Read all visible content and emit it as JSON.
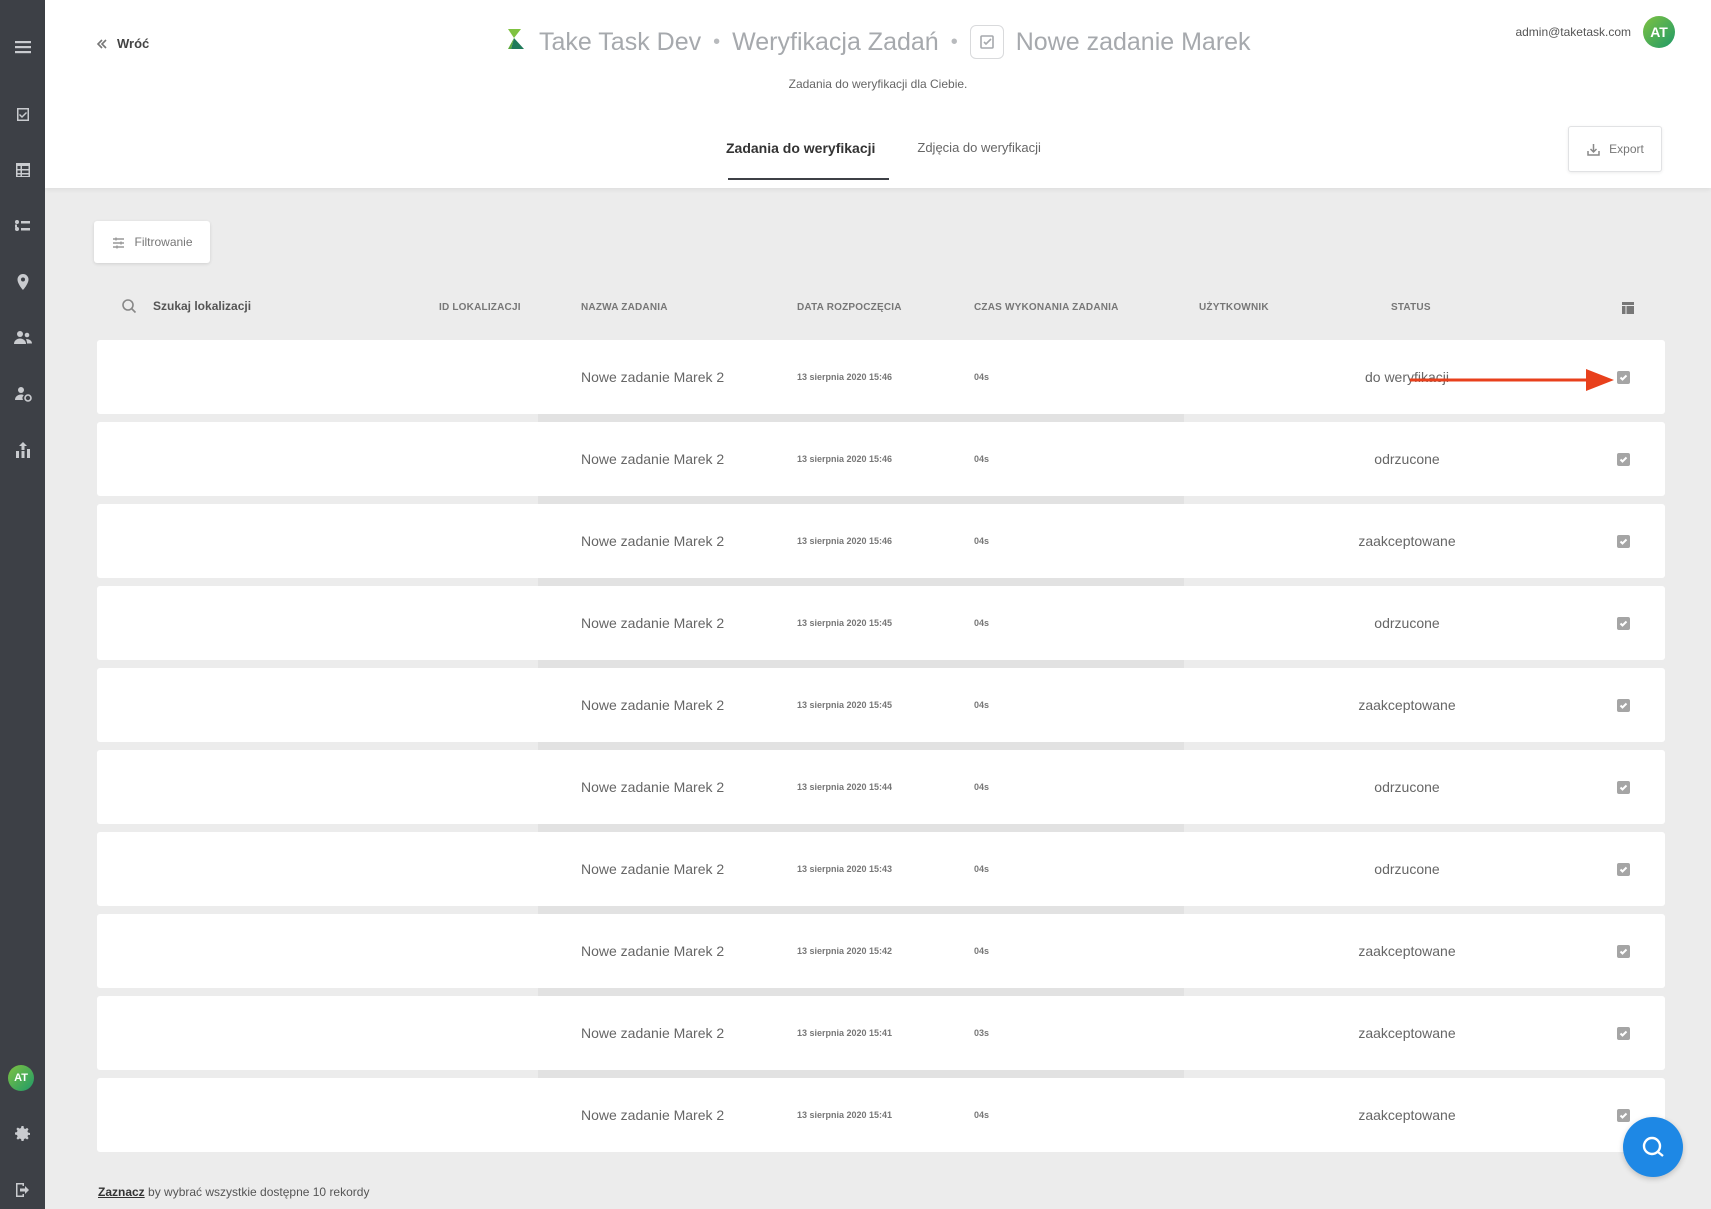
{
  "header": {
    "back_label": "Wróć",
    "breadcrumb": [
      "Take Task Dev",
      "Weryfikacja Zadań",
      "Nowe zadanie Marek"
    ],
    "subtitle": "Zadania do weryfikacji dla Ciebie.",
    "user_email": "admin@taketask.com",
    "user_initials": "AT"
  },
  "tabs": [
    {
      "label": "Zadania do weryfikacji",
      "active": true
    },
    {
      "label": "Zdjęcia do weryfikacji",
      "active": false
    }
  ],
  "toolbar": {
    "export_label": "Export",
    "filter_label": "Filtrowanie"
  },
  "table": {
    "search_placeholder": "Szukaj lokalizacji",
    "columns": [
      "ID LOKALIZACJI",
      "NAZWA ZADANIA",
      "DATA ROZPOCZĘCIA",
      "CZAS WYKONANIA ZADANIA",
      "UŻYTKOWNIK",
      "STATUS"
    ],
    "rows": [
      {
        "name": "Nowe zadanie Marek 2",
        "date": "13 sierpnia 2020 15:46",
        "time": "04s",
        "status": "do weryfikacji"
      },
      {
        "name": "Nowe zadanie Marek 2",
        "date": "13 sierpnia 2020 15:46",
        "time": "04s",
        "status": "odrzucone"
      },
      {
        "name": "Nowe zadanie Marek 2",
        "date": "13 sierpnia 2020 15:46",
        "time": "04s",
        "status": "zaakceptowane"
      },
      {
        "name": "Nowe zadanie Marek 2",
        "date": "13 sierpnia 2020 15:45",
        "time": "04s",
        "status": "odrzucone"
      },
      {
        "name": "Nowe zadanie Marek 2",
        "date": "13 sierpnia 2020 15:45",
        "time": "04s",
        "status": "zaakceptowane"
      },
      {
        "name": "Nowe zadanie Marek 2",
        "date": "13 sierpnia 2020 15:44",
        "time": "04s",
        "status": "odrzucone"
      },
      {
        "name": "Nowe zadanie Marek 2",
        "date": "13 sierpnia 2020 15:43",
        "time": "04s",
        "status": "odrzucone"
      },
      {
        "name": "Nowe zadanie Marek 2",
        "date": "13 sierpnia 2020 15:42",
        "time": "04s",
        "status": "zaakceptowane"
      },
      {
        "name": "Nowe zadanie Marek 2",
        "date": "13 sierpnia 2020 15:41",
        "time": "03s",
        "status": "zaakceptowane"
      },
      {
        "name": "Nowe zadanie Marek 2",
        "date": "13 sierpnia 2020 15:41",
        "time": "04s",
        "status": "zaakceptowane"
      }
    ]
  },
  "footer": {
    "select_link": "Zaznacz",
    "select_text": " by wybrać wszystkie dostępne 10 rekordy"
  },
  "sidebar": {
    "items": [
      "menu-icon",
      "tasks-icon",
      "table-icon",
      "routes-icon",
      "location-icon",
      "users-icon",
      "user-settings-icon",
      "stats-icon"
    ],
    "avatar_initials": "AT"
  },
  "colors": {
    "sidebar_bg": "#3d4046",
    "accent_green": "#7fc241",
    "help_blue": "#1e88e5",
    "annotation_arrow": "#e8401c"
  }
}
